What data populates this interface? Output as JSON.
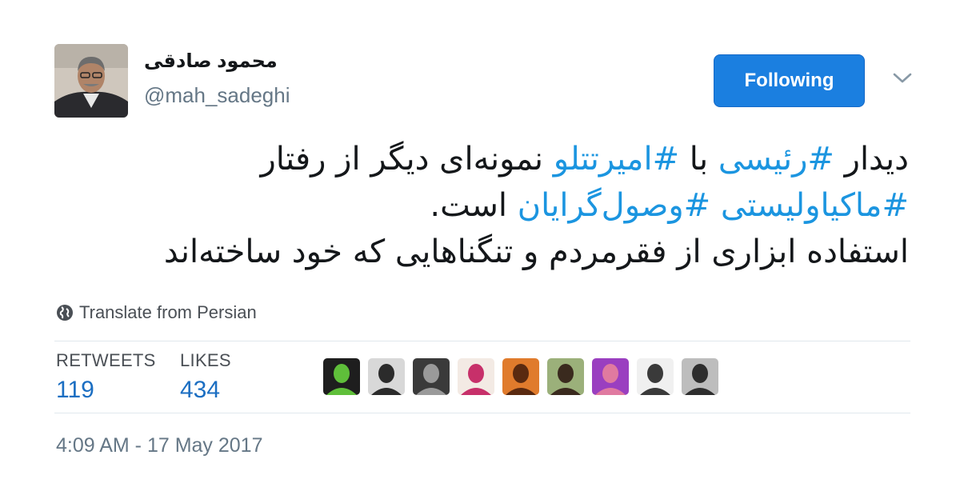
{
  "author": {
    "display_name": "محمود صادقی",
    "handle": "@mah_sadeghi"
  },
  "follow_button_label": "Following",
  "tweet_lines": [
    [
      {
        "text": "دیدار ",
        "hashtag": false
      },
      {
        "text": "#رئیسی",
        "hashtag": true
      },
      {
        "text": " با ",
        "hashtag": false
      },
      {
        "text": "#امیرتتلو",
        "hashtag": true
      },
      {
        "text": " نمونه‌ای دیگر از رفتار",
        "hashtag": false
      }
    ],
    [
      {
        "text": "#ماکیاولیستی",
        "hashtag": true
      },
      {
        "text": " ",
        "hashtag": false
      },
      {
        "text": "#وصول‌گرایان",
        "hashtag": true
      },
      {
        "text": " است.",
        "hashtag": false
      }
    ],
    [
      {
        "text": "استفاده ابزاری از فقرمردم و تنگناهایی که خود ساخته‌اند",
        "hashtag": false
      }
    ]
  ],
  "translate_label": "Translate from Persian",
  "stats": {
    "retweets_label": "RETWEETS",
    "retweets_value": "119",
    "likes_label": "LIKES",
    "likes_value": "434"
  },
  "liker_avatars": [
    {
      "name": "liker-avatar-1",
      "bg": "#1e1e1e",
      "fg": "#5fbf3a"
    },
    {
      "name": "liker-avatar-2",
      "bg": "#d8d8d8",
      "fg": "#2b2b2b"
    },
    {
      "name": "liker-avatar-3",
      "bg": "#3a3a3a",
      "fg": "#9a9a9a"
    },
    {
      "name": "liker-avatar-4",
      "bg": "#f3eae4",
      "fg": "#c7306a"
    },
    {
      "name": "liker-avatar-5",
      "bg": "#e07b2c",
      "fg": "#5a2a10"
    },
    {
      "name": "liker-avatar-6",
      "bg": "#9bb07a",
      "fg": "#3a2a1e"
    },
    {
      "name": "liker-avatar-7",
      "bg": "#9a3fc0",
      "fg": "#e07aa0"
    },
    {
      "name": "liker-avatar-8",
      "bg": "#f0f0f0",
      "fg": "#3a3a3a"
    },
    {
      "name": "liker-avatar-9",
      "bg": "#bdbdbd",
      "fg": "#2e2e2e"
    }
  ],
  "timestamp": "4:09 AM - 17 May 2017",
  "colors": {
    "follow_button": "#1b7fe0",
    "hashtag": "#1b95e0",
    "stat_value": "#1b6ec2"
  }
}
